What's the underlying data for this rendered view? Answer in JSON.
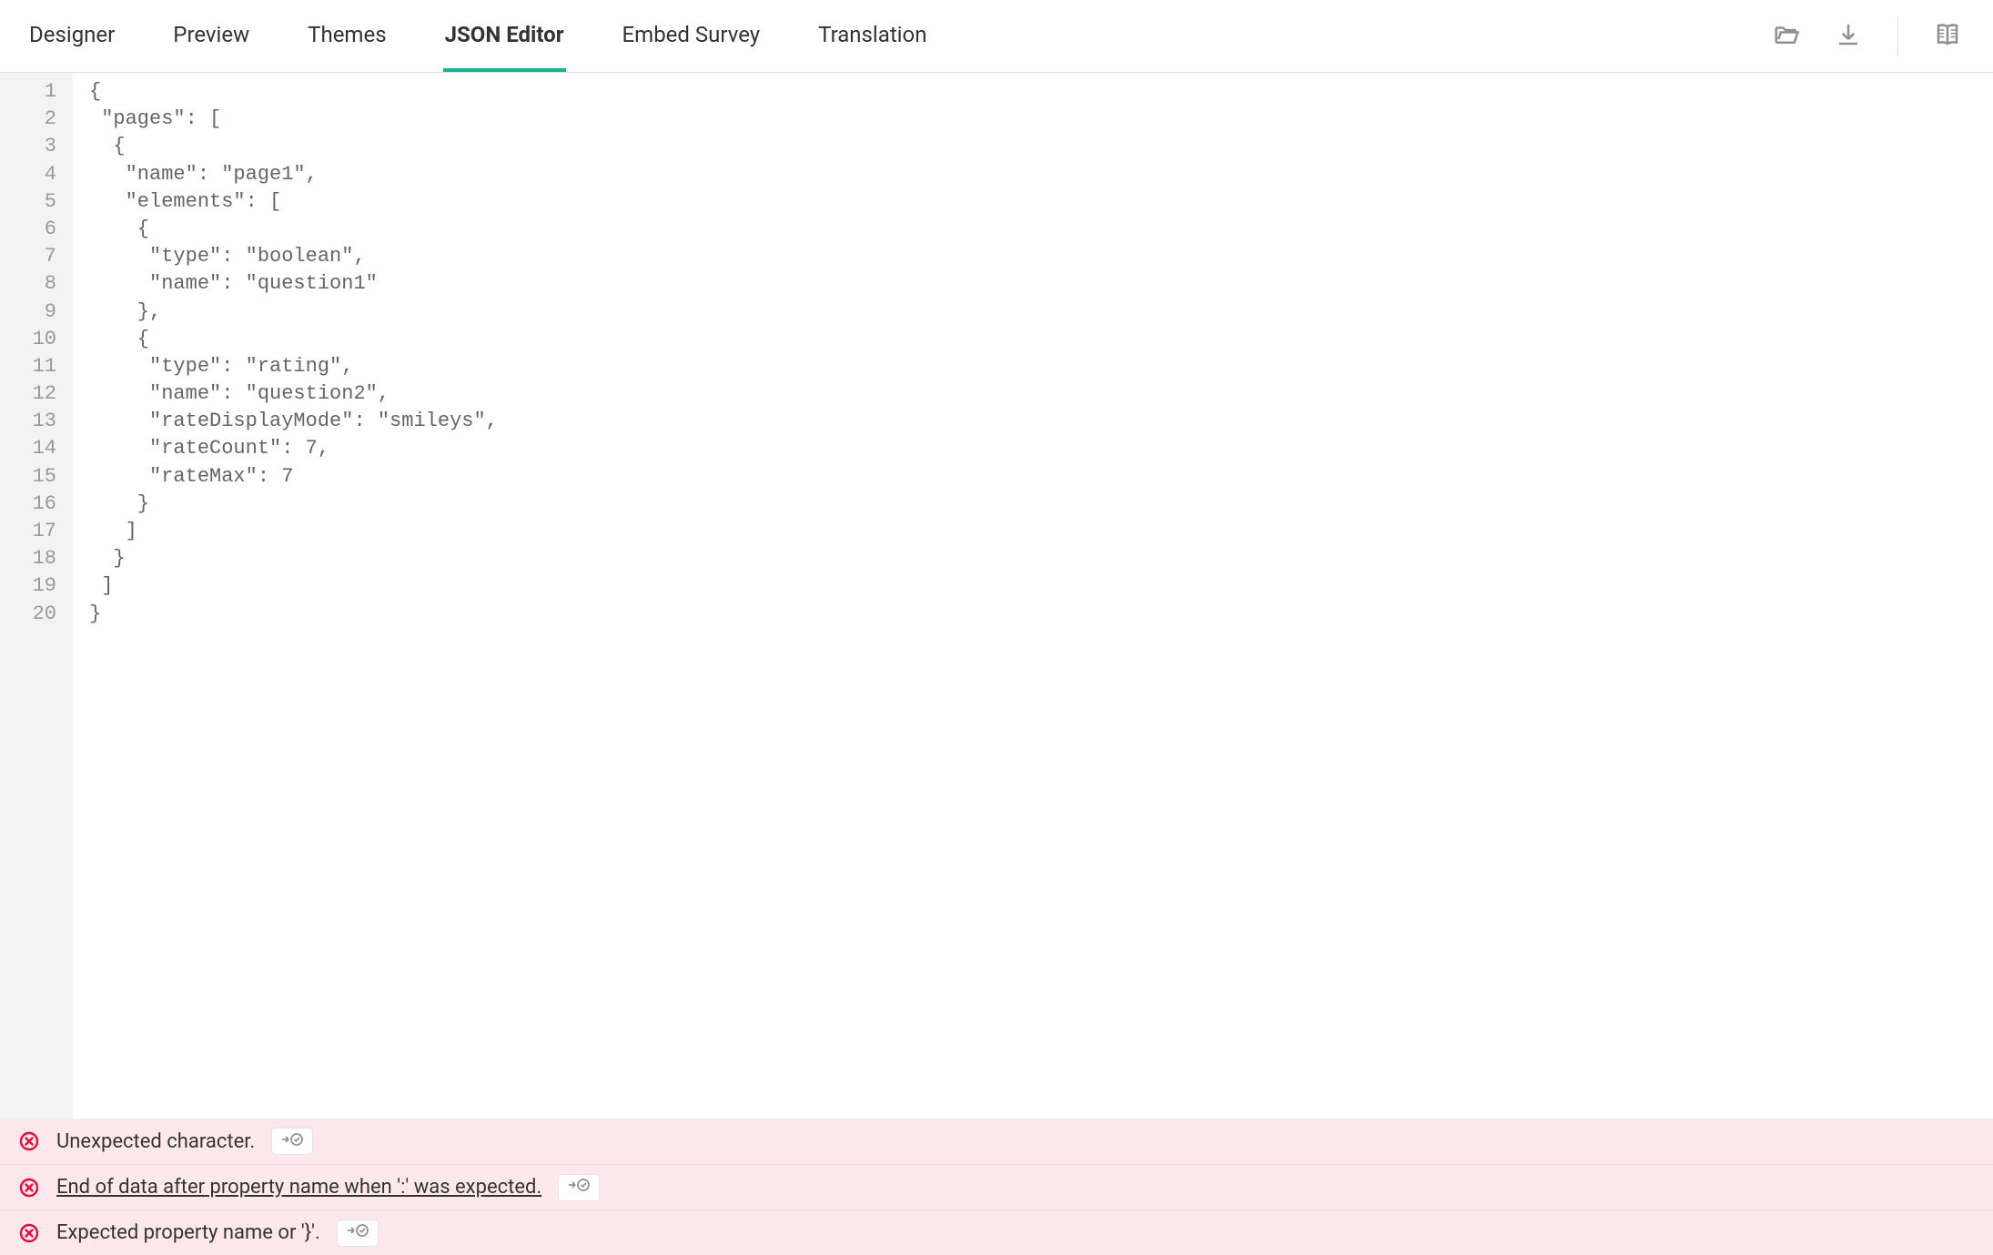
{
  "tabs": [
    {
      "label": "Designer",
      "active": false
    },
    {
      "label": "Preview",
      "active": false
    },
    {
      "label": "Themes",
      "active": false
    },
    {
      "label": "JSON Editor",
      "active": true
    },
    {
      "label": "Embed Survey",
      "active": false
    },
    {
      "label": "Translation",
      "active": false
    }
  ],
  "toolbar_icons": {
    "open": "folder-open-icon",
    "download": "download-icon",
    "docs": "book-open-icon"
  },
  "code_lines": [
    "{",
    " \"pages\": [",
    "  {",
    "   \"name\": \"page1\",",
    "   \"elements\": [",
    "    {",
    "     \"type\": \"boolean\",",
    "     \"name\": \"question1\"",
    "    },",
    "    {",
    "     \"type\": \"rating\",",
    "     \"name\": \"question2\",",
    "     \"rateDisplayMode\": \"smileys\",",
    "     \"rateCount\": 7,",
    "     \"rateMax\": 7",
    "    }",
    "   ]",
    "  }",
    " ]",
    "}"
  ],
  "errors": [
    {
      "message": "Unexpected character.",
      "underline": false
    },
    {
      "message": "End of data after property name when ':' was expected.",
      "underline": true
    },
    {
      "message": "Expected property name or '}'.",
      "underline": false
    }
  ],
  "colors": {
    "accent": "#19b394",
    "error": "#e60a3e",
    "error_bg": "#fde9ed",
    "gutter_bg": "#f3f3f3",
    "border": "#e0e0e0"
  }
}
